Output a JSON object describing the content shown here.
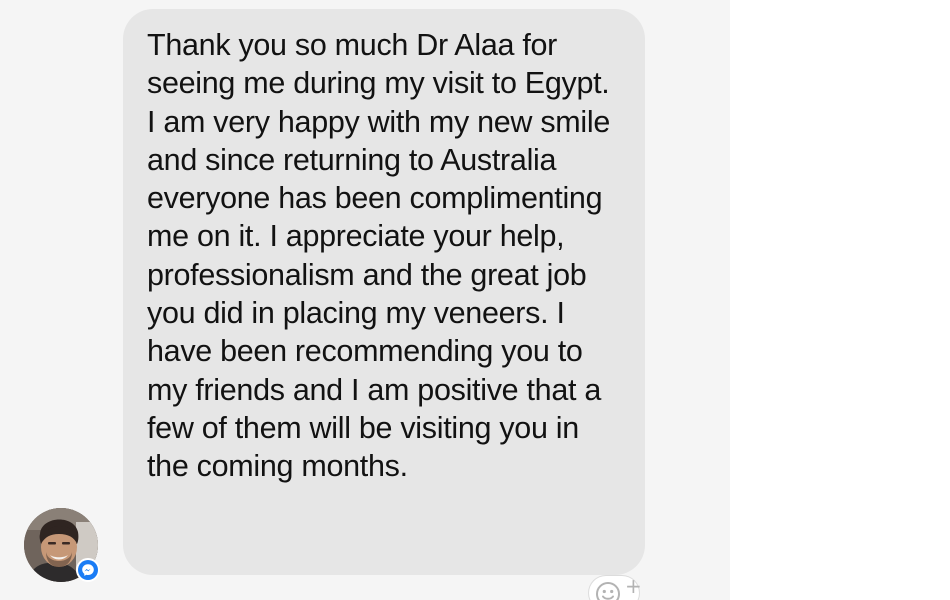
{
  "conversation": {
    "message": {
      "text": "Thank you so much Dr Alaa for seeing me during my visit to Egypt. I am very happy with my new smile and since returning to Australia everyone has been complimenting me on it. I appreciate your help, professionalism and the great job you did in placing my veneers. I have been recommending you to my friends and I am positive that a few of them will be visiting you in the coming months."
    },
    "sender": {
      "avatar_icon": "person-avatar",
      "badge_icon": "messenger-icon"
    },
    "reaction": {
      "icon": "smiley-face-icon",
      "plus_label": "+"
    }
  },
  "colors": {
    "chat_background": "#f5f5f5",
    "bubble_background": "#e6e6e6",
    "message_text": "#121212",
    "messenger_blue": "#1a7cf5",
    "reaction_icon": "#b3b3b3"
  }
}
